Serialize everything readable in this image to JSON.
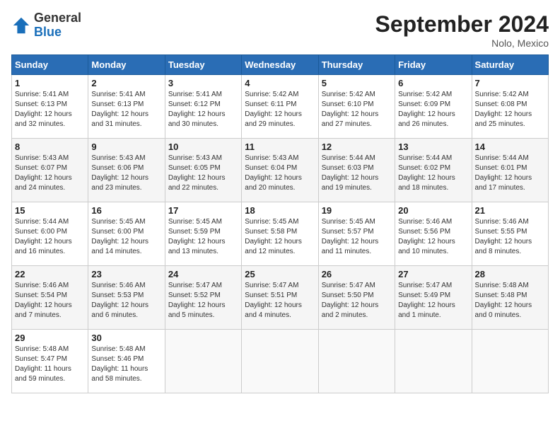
{
  "header": {
    "logo_general": "General",
    "logo_blue": "Blue",
    "month_title": "September 2024",
    "location": "Nolo, Mexico"
  },
  "calendar": {
    "days_of_week": [
      "Sunday",
      "Monday",
      "Tuesday",
      "Wednesday",
      "Thursday",
      "Friday",
      "Saturday"
    ],
    "weeks": [
      [
        {
          "day": "",
          "info": ""
        },
        {
          "day": "2",
          "info": "Sunrise: 5:41 AM\nSunset: 6:13 PM\nDaylight: 12 hours\nand 31 minutes."
        },
        {
          "day": "3",
          "info": "Sunrise: 5:41 AM\nSunset: 6:12 PM\nDaylight: 12 hours\nand 30 minutes."
        },
        {
          "day": "4",
          "info": "Sunrise: 5:42 AM\nSunset: 6:11 PM\nDaylight: 12 hours\nand 29 minutes."
        },
        {
          "day": "5",
          "info": "Sunrise: 5:42 AM\nSunset: 6:10 PM\nDaylight: 12 hours\nand 27 minutes."
        },
        {
          "day": "6",
          "info": "Sunrise: 5:42 AM\nSunset: 6:09 PM\nDaylight: 12 hours\nand 26 minutes."
        },
        {
          "day": "7",
          "info": "Sunrise: 5:42 AM\nSunset: 6:08 PM\nDaylight: 12 hours\nand 25 minutes."
        }
      ],
      [
        {
          "day": "8",
          "info": "Sunrise: 5:43 AM\nSunset: 6:07 PM\nDaylight: 12 hours\nand 24 minutes."
        },
        {
          "day": "9",
          "info": "Sunrise: 5:43 AM\nSunset: 6:06 PM\nDaylight: 12 hours\nand 23 minutes."
        },
        {
          "day": "10",
          "info": "Sunrise: 5:43 AM\nSunset: 6:05 PM\nDaylight: 12 hours\nand 22 minutes."
        },
        {
          "day": "11",
          "info": "Sunrise: 5:43 AM\nSunset: 6:04 PM\nDaylight: 12 hours\nand 20 minutes."
        },
        {
          "day": "12",
          "info": "Sunrise: 5:44 AM\nSunset: 6:03 PM\nDaylight: 12 hours\nand 19 minutes."
        },
        {
          "day": "13",
          "info": "Sunrise: 5:44 AM\nSunset: 6:02 PM\nDaylight: 12 hours\nand 18 minutes."
        },
        {
          "day": "14",
          "info": "Sunrise: 5:44 AM\nSunset: 6:01 PM\nDaylight: 12 hours\nand 17 minutes."
        }
      ],
      [
        {
          "day": "15",
          "info": "Sunrise: 5:44 AM\nSunset: 6:00 PM\nDaylight: 12 hours\nand 16 minutes."
        },
        {
          "day": "16",
          "info": "Sunrise: 5:45 AM\nSunset: 6:00 PM\nDaylight: 12 hours\nand 14 minutes."
        },
        {
          "day": "17",
          "info": "Sunrise: 5:45 AM\nSunset: 5:59 PM\nDaylight: 12 hours\nand 13 minutes."
        },
        {
          "day": "18",
          "info": "Sunrise: 5:45 AM\nSunset: 5:58 PM\nDaylight: 12 hours\nand 12 minutes."
        },
        {
          "day": "19",
          "info": "Sunrise: 5:45 AM\nSunset: 5:57 PM\nDaylight: 12 hours\nand 11 minutes."
        },
        {
          "day": "20",
          "info": "Sunrise: 5:46 AM\nSunset: 5:56 PM\nDaylight: 12 hours\nand 10 minutes."
        },
        {
          "day": "21",
          "info": "Sunrise: 5:46 AM\nSunset: 5:55 PM\nDaylight: 12 hours\nand 8 minutes."
        }
      ],
      [
        {
          "day": "22",
          "info": "Sunrise: 5:46 AM\nSunset: 5:54 PM\nDaylight: 12 hours\nand 7 minutes."
        },
        {
          "day": "23",
          "info": "Sunrise: 5:46 AM\nSunset: 5:53 PM\nDaylight: 12 hours\nand 6 minutes."
        },
        {
          "day": "24",
          "info": "Sunrise: 5:47 AM\nSunset: 5:52 PM\nDaylight: 12 hours\nand 5 minutes."
        },
        {
          "day": "25",
          "info": "Sunrise: 5:47 AM\nSunset: 5:51 PM\nDaylight: 12 hours\nand 4 minutes."
        },
        {
          "day": "26",
          "info": "Sunrise: 5:47 AM\nSunset: 5:50 PM\nDaylight: 12 hours\nand 2 minutes."
        },
        {
          "day": "27",
          "info": "Sunrise: 5:47 AM\nSunset: 5:49 PM\nDaylight: 12 hours\nand 1 minute."
        },
        {
          "day": "28",
          "info": "Sunrise: 5:48 AM\nSunset: 5:48 PM\nDaylight: 12 hours\nand 0 minutes."
        }
      ],
      [
        {
          "day": "29",
          "info": "Sunrise: 5:48 AM\nSunset: 5:47 PM\nDaylight: 11 hours\nand 59 minutes."
        },
        {
          "day": "30",
          "info": "Sunrise: 5:48 AM\nSunset: 5:46 PM\nDaylight: 11 hours\nand 58 minutes."
        },
        {
          "day": "",
          "info": ""
        },
        {
          "day": "",
          "info": ""
        },
        {
          "day": "",
          "info": ""
        },
        {
          "day": "",
          "info": ""
        },
        {
          "day": "",
          "info": ""
        }
      ]
    ],
    "first_row": [
      {
        "day": "1",
        "info": "Sunrise: 5:41 AM\nSunset: 6:13 PM\nDaylight: 12 hours\nand 32 minutes."
      }
    ]
  }
}
